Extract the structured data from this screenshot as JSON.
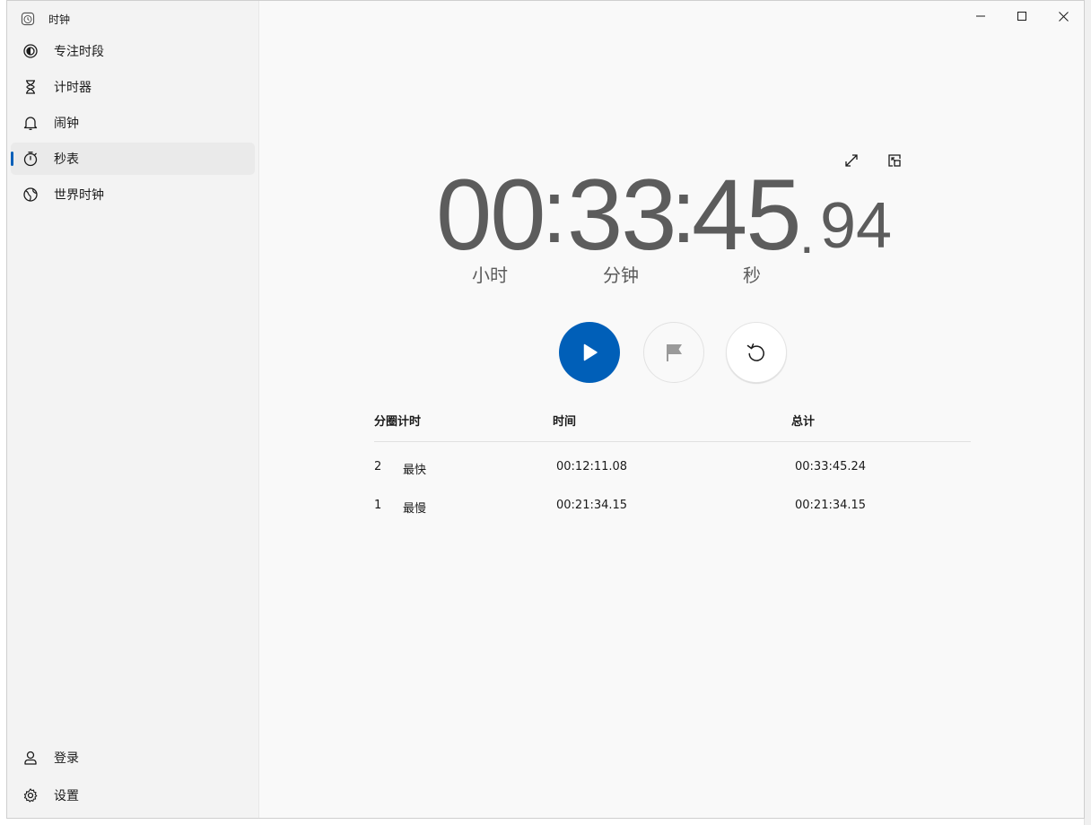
{
  "app": {
    "title": "时钟"
  },
  "window_controls": [
    "minimize",
    "maximize",
    "close"
  ],
  "sidebar": {
    "items": [
      {
        "label": "专注时段",
        "icon": "focus-icon"
      },
      {
        "label": "计时器",
        "icon": "hourglass-icon"
      },
      {
        "label": "闹钟",
        "icon": "bell-icon"
      },
      {
        "label": "秒表",
        "icon": "stopwatch-icon",
        "active": true
      },
      {
        "label": "世界时钟",
        "icon": "globe-icon"
      }
    ],
    "bottom": [
      {
        "label": "登录",
        "icon": "user-icon"
      },
      {
        "label": "设置",
        "icon": "gear-icon"
      }
    ]
  },
  "stopwatch": {
    "hours": "00",
    "minutes": "33",
    "seconds": "45",
    "hundredths": "94",
    "sep": ":",
    "dot": ".",
    "units": {
      "hours": "小时",
      "minutes": "分钟",
      "seconds": "秒"
    }
  },
  "laps": {
    "headers": {
      "lap": "分圈计时",
      "time": "时间",
      "total": "总计"
    },
    "rows": [
      {
        "num": "2",
        "tag": "最快",
        "time": "00:12:11.08",
        "total": "00:33:45.24"
      },
      {
        "num": "1",
        "tag": "最慢",
        "time": "00:21:34.15",
        "total": "00:21:34.15"
      }
    ]
  },
  "colors": {
    "accent": "#005fb8",
    "digits": "#5c5c5c",
    "window": "#f9f9f9",
    "sidebar": "#f3f3f3"
  }
}
